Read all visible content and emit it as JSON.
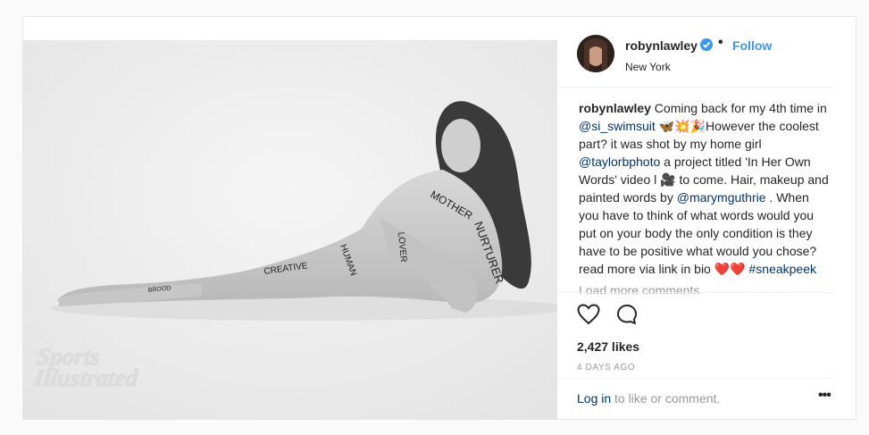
{
  "post": {
    "brand_watermark_line1": "Sports",
    "brand_watermark_line2": "Illustrated",
    "body_words": [
      "MOTHER",
      "NURTURER",
      "HUMAN",
      "CREATIVE",
      "LOVER",
      "BROOD"
    ]
  },
  "header": {
    "username": "robynlawley",
    "separator": "•",
    "follow_label": "Follow",
    "location": "New York",
    "verified_color": "#3897f0"
  },
  "caption": {
    "author": "robynlawley",
    "part1": " Coming back for my 4th time in ",
    "mention1": "@si_swimsuit",
    "emojis1": " 🦋💥🎉",
    "part2": "However the coolest part? it was shot by my home girl ",
    "mention2": "@taylorbphoto",
    "part3": " a project titled 'In Her Own Words' video l 🎥 to come. Hair, makeup and painted words by ",
    "mention3": "@marymguthrie",
    "part4": " . When you have to think of what words would you put on your body the only condition is they have to be positive what would you chose?read more via link in bio ❤️❤️ ",
    "hashtag": "#sneakpeek",
    "load_more": "Load more comments"
  },
  "engagement": {
    "likes": "2,427 likes",
    "timestamp": "4 DAYS AGO"
  },
  "footer": {
    "login_label": "Log in",
    "login_suffix": " to like or comment.",
    "more_label": "•••"
  },
  "icons": {
    "heart": "heart-icon",
    "comment": "comment-icon",
    "more": "more-icon",
    "verified": "verified-badge-icon"
  }
}
